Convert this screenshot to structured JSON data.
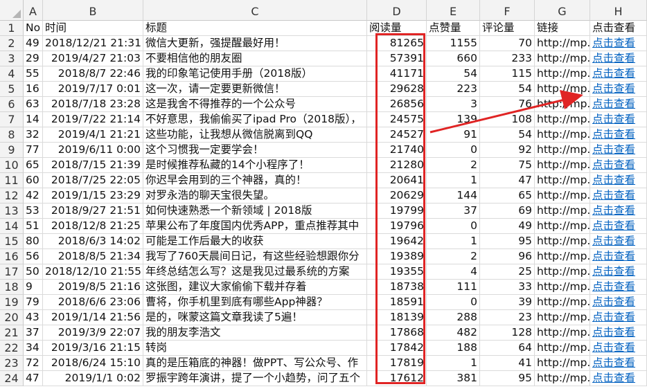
{
  "columns": [
    "A",
    "B",
    "C",
    "D",
    "E",
    "F",
    "G",
    "H"
  ],
  "header": {
    "no": "No",
    "time": "时间",
    "title": "标题",
    "reads": "阅读量",
    "likes": "点赞量",
    "comments": "评论量",
    "link": "链接",
    "view": "点击查看"
  },
  "row_numbers": [
    "1",
    "2",
    "3",
    "4",
    "5",
    "6",
    "7",
    "8",
    "9",
    "10",
    "11",
    "12",
    "13",
    "14",
    "15",
    "16",
    "17",
    "18",
    "19",
    "20",
    "21",
    "22",
    "23",
    "24"
  ],
  "rows": [
    {
      "no": "49",
      "time": "2018/12/21 21:31",
      "title": "微信大更新，强提醒最好用！",
      "reads": "81265",
      "likes": "1155",
      "comments": "70",
      "link": "http://mp.w",
      "view": "点击查看"
    },
    {
      "no": "29",
      "time": "2019/4/27 21:03",
      "title": "不要相信他的朋友圈",
      "reads": "57391",
      "likes": "660",
      "comments": "233",
      "link": "http://mp.w",
      "view": "点击查看"
    },
    {
      "no": "55",
      "time": "2018/8/7 22:46",
      "title": "我的印象笔记使用手册（2018版）",
      "reads": "41171",
      "likes": "54",
      "comments": "115",
      "link": "http://mp.w",
      "view": "点击查看"
    },
    {
      "no": "16",
      "time": "2019/7/17 0:01",
      "title": "这一次，请一定要更新微信！",
      "reads": "29628",
      "likes": "223",
      "comments": "54",
      "link": "http://mp.w",
      "view": "点击查看"
    },
    {
      "no": "63",
      "time": "2018/7/18 23:28",
      "title": "这是我舍不得推荐的一个公众号",
      "reads": "26856",
      "likes": "3",
      "comments": "76",
      "link": "http://mp.w",
      "view": "点击查看"
    },
    {
      "no": "14",
      "time": "2019/7/22 21:14",
      "title": "不好意思，我偷偷买了ipad Pro（2018版），",
      "reads": "24575",
      "likes": "139",
      "comments": "108",
      "link": "http://mp.w",
      "view": "点击查看"
    },
    {
      "no": "32",
      "time": "2019/4/1 21:21",
      "title": "这些功能，让我想从微信脱离到QQ",
      "reads": "24527",
      "likes": "91",
      "comments": "54",
      "link": "http://mp.w",
      "view": "点击查看"
    },
    {
      "no": "77",
      "time": "2019/6/11 0:00",
      "title": "这个习惯我一定要学会！",
      "reads": "21740",
      "likes": "0",
      "comments": "92",
      "link": "http://mp.w",
      "view": "点击查看"
    },
    {
      "no": "65",
      "time": "2018/7/15 21:39",
      "title": "是时候推荐私藏的14个小程序了！",
      "reads": "21280",
      "likes": "2",
      "comments": "75",
      "link": "http://mp.w",
      "view": "点击查看"
    },
    {
      "no": "60",
      "time": "2018/7/25 22:05",
      "title": "你迟早会用到的三个神器，真的！",
      "reads": "20641",
      "likes": "1",
      "comments": "47",
      "link": "http://mp.w",
      "view": "点击查看"
    },
    {
      "no": "42",
      "time": "2019/1/15 23:29",
      "title": "对罗永浩的聊天宝很失望。",
      "reads": "20629",
      "likes": "144",
      "comments": "65",
      "link": "http://mp.w",
      "view": "点击查看"
    },
    {
      "no": "53",
      "time": "2018/9/27 21:51",
      "title": "如何快速熟悉一个新领域 | 2018版",
      "reads": "19799",
      "likes": "37",
      "comments": "69",
      "link": "http://mp.w",
      "view": "点击查看"
    },
    {
      "no": "51",
      "time": "2018/12/8 21:25",
      "title": "苹果公布了年度国内优秀APP，重点推荐其中",
      "reads": "19796",
      "likes": "0",
      "comments": "49",
      "link": "http://mp.w",
      "view": "点击查看"
    },
    {
      "no": "80",
      "time": "2018/6/3 14:02",
      "title": "可能是工作后最大的收获",
      "reads": "19642",
      "likes": "1",
      "comments": "95",
      "link": "http://mp.w",
      "view": "点击查看"
    },
    {
      "no": "56",
      "time": "2018/8/5 21:34",
      "title": "我写了760天晨间日记，有这些经验想跟你分",
      "reads": "19389",
      "likes": "2",
      "comments": "96",
      "link": "http://mp.w",
      "view": "点击查看"
    },
    {
      "no": "50",
      "time": "2018/12/10 21:55",
      "title": "年终总结怎么写？这是我见过最系统的方案",
      "reads": "19355",
      "likes": "4",
      "comments": "25",
      "link": "http://mp.w",
      "view": "点击查看"
    },
    {
      "no": "9",
      "time": "2019/8/5 21:16",
      "title": "这张图，建议大家偷偷下载并存着",
      "reads": "18738",
      "likes": "111",
      "comments": "33",
      "link": "http://mp.w",
      "view": "点击查看"
    },
    {
      "no": "79",
      "time": "2018/6/6 23:06",
      "title": "曹将，你手机里到底有哪些App神器？",
      "reads": "18591",
      "likes": "0",
      "comments": "39",
      "link": "http://mp.w",
      "view": "点击查看"
    },
    {
      "no": "43",
      "time": "2019/1/14 21:56",
      "title": "是的，咪蒙这篇文章我读了5遍！",
      "reads": "18139",
      "likes": "288",
      "comments": "23",
      "link": "http://mp.w",
      "view": "点击查看"
    },
    {
      "no": "37",
      "time": "2019/3/9 22:07",
      "title": "我的朋友李浩文",
      "reads": "17868",
      "likes": "482",
      "comments": "128",
      "link": "http://mp.w",
      "view": "点击查看"
    },
    {
      "no": "34",
      "time": "2019/3/16 21:15",
      "title": "转岗",
      "reads": "17842",
      "likes": "188",
      "comments": "64",
      "link": "http://mp.w",
      "view": "点击查看"
    },
    {
      "no": "72",
      "time": "2018/6/24 15:10",
      "title": "真的是压箱底的神器！做PPT、写公众号、作",
      "reads": "17819",
      "likes": "1",
      "comments": "41",
      "link": "http://mp.w",
      "view": "点击查看"
    },
    {
      "no": "47",
      "time": "2019/1/1 0:02",
      "title": "罗振宇跨年演讲，提了一个小趋势，问了五个",
      "reads": "17612",
      "likes": "381",
      "comments": "95",
      "link": "http://mp.w",
      "view": "点击查看"
    }
  ],
  "colors": {
    "highlight": "#e02424",
    "link": "#0563c1",
    "header_bg": "#f3f3f3"
  }
}
